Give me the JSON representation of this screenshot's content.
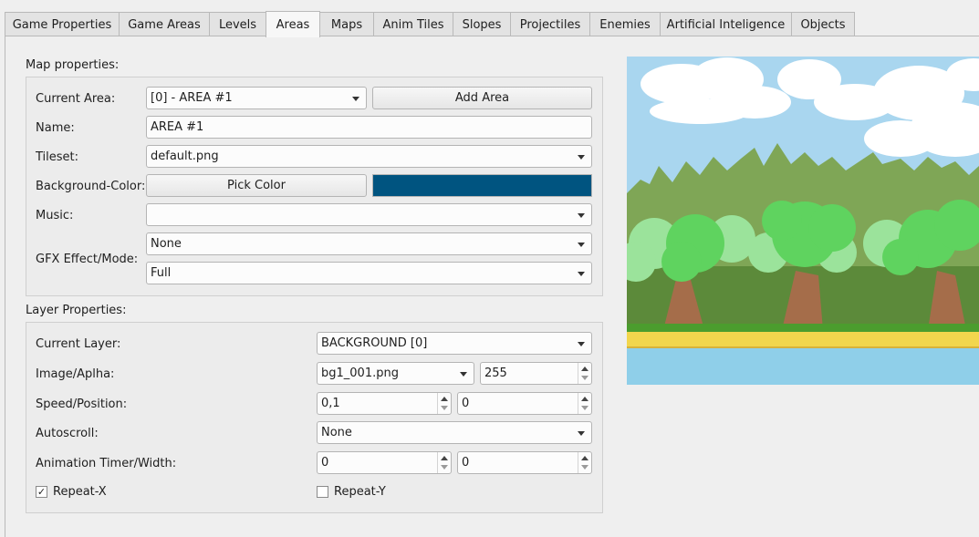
{
  "tabs": [
    {
      "label": "Game Properties",
      "active": false
    },
    {
      "label": "Game Areas",
      "active": false
    },
    {
      "label": "Levels",
      "active": false
    },
    {
      "label": "Areas",
      "active": true
    },
    {
      "label": "Maps",
      "active": false
    },
    {
      "label": "Anim Tiles",
      "active": false
    },
    {
      "label": "Slopes",
      "active": false
    },
    {
      "label": "Projectiles",
      "active": false
    },
    {
      "label": "Enemies",
      "active": false
    },
    {
      "label": "Artificial Inteligence",
      "active": false
    },
    {
      "label": "Objects",
      "active": false
    }
  ],
  "map_properties": {
    "title": "Map properties:",
    "current_area_label": "Current Area:",
    "current_area_value": "[0] - AREA #1",
    "add_area_label": "Add Area",
    "name_label": "Name:",
    "name_value": "AREA #1",
    "tileset_label": "Tileset:",
    "tileset_value": "default.png",
    "bg_color_label": "Background-Color:",
    "pick_color_label": "Pick Color",
    "bg_color_value": "#005480",
    "music_label": "Music:",
    "music_value": "",
    "gfx_label": "GFX Effect/Mode:",
    "gfx_effect_value": "None",
    "gfx_mode_value": "Full"
  },
  "layer_properties": {
    "title": "Layer Properties:",
    "current_layer_label": "Current Layer:",
    "current_layer_value": "BACKGROUND [0]",
    "image_alpha_label": "Image/Aplha:",
    "image_value": "bg1_001.png",
    "alpha_value": "255",
    "speed_position_label": "Speed/Position:",
    "speed_value": "0,1",
    "position_value": "0",
    "autoscroll_label": "Autoscroll:",
    "autoscroll_value": "None",
    "anim_label": "Animation Timer/Width:",
    "anim_timer_value": "0",
    "anim_width_value": "0",
    "repeat_x_label": "Repeat-X",
    "repeat_x_checked": true,
    "repeat_y_label": "Repeat-Y",
    "repeat_y_checked": false,
    "check_mark": "✓"
  },
  "preview": {
    "sky_color": "#a9d6ef",
    "forest_back_color": "#7fa656",
    "forest_mid_color": "#5c8a3a",
    "tree_light_color": "#5fd35f",
    "tree_pale_color": "#9be39b",
    "trunk_color": "#a56d4a",
    "ground_color": "#f2d64d",
    "below_color": "#8fcfe9"
  }
}
